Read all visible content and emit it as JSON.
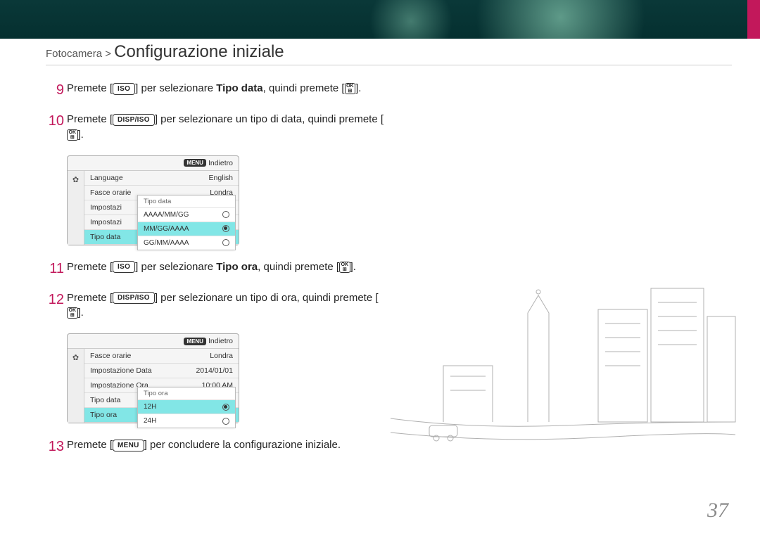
{
  "accent_color": "#c2185b",
  "breadcrumb": {
    "path": "Fotocamera >",
    "title": "Configurazione iniziale"
  },
  "buttons": {
    "iso": "ISO",
    "disp": "DISP",
    "menu": "MENU",
    "ok_top": "OK",
    "ok_bot": "⊞"
  },
  "steps": [
    {
      "num": "9",
      "pre": "Premete [",
      "btn1": "ISO",
      "mid": "] per selezionare ",
      "bold": "Tipo data",
      "post": ", quindi premete [",
      "btnEnd": "OK",
      "post2": "]."
    },
    {
      "num": "10",
      "pre": "Premete [",
      "btn1": "DISP/ISO",
      "mid": "] per selezionare un tipo di data, quindi premete [",
      "bold": "",
      "post": "",
      "btnEnd": "OK",
      "post2": "]."
    },
    {
      "num": "11",
      "pre": "Premete [",
      "btn1": "ISO",
      "mid": "] per selezionare ",
      "bold": "Tipo ora",
      "post": ", quindi premete [",
      "btnEnd": "OK",
      "post2": "]."
    },
    {
      "num": "12",
      "pre": "Premete [",
      "btn1": "DISP/ISO",
      "mid": "] per selezionare un tipo di ora, quindi premete [",
      "bold": "",
      "post": "",
      "btnEnd": "OK",
      "post2": "]."
    },
    {
      "num": "13",
      "pre": "Premete [",
      "btn1": "MENU",
      "mid": "] per concludere la configurazione iniziale.",
      "bold": "",
      "post": "",
      "btnEnd": "",
      "post2": ""
    }
  ],
  "screen1": {
    "back_label": "Indietro",
    "rows": [
      {
        "label": "Language",
        "value": "English"
      },
      {
        "label": "Fasce orarie",
        "value": "Londra"
      },
      {
        "label": "Impostazi",
        "value": ""
      },
      {
        "label": "Impostazi",
        "value": ""
      },
      {
        "label": "Tipo data",
        "value": "",
        "hl": true
      }
    ],
    "popup_title": "Tipo data",
    "popup": [
      {
        "label": "AAAA/MM/GG",
        "sel": false
      },
      {
        "label": "MM/GG/AAAA",
        "sel": true
      },
      {
        "label": "GG/MM/AAAA",
        "sel": false
      }
    ]
  },
  "screen2": {
    "back_label": "Indietro",
    "rows": [
      {
        "label": "Fasce orarie",
        "value": "Londra"
      },
      {
        "label": "Impostazione Data",
        "value": "2014/01/01"
      },
      {
        "label": "Impostazione Ora",
        "value": "10:00 AM"
      },
      {
        "label": "Tipo data",
        "value": ""
      },
      {
        "label": "Tipo ora",
        "value": "",
        "hl": true
      }
    ],
    "popup_title": "Tipo ora",
    "popup": [
      {
        "label": "12H",
        "sel": true
      },
      {
        "label": "24H",
        "sel": false
      }
    ]
  },
  "page_number": "37"
}
